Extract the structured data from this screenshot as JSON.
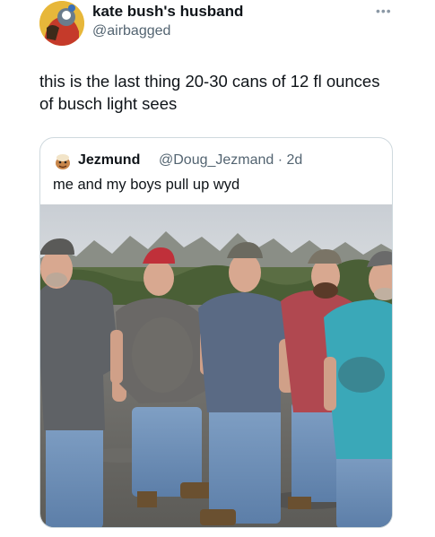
{
  "tweet": {
    "display_name": "kate bush's husband",
    "handle": "@airbagged",
    "more_icon": "more-horizontal-icon",
    "text": "this is the last thing 20-30 cans of 12 fl ounces of busch light sees"
  },
  "quoted_tweet": {
    "display_name": "Jezmund",
    "handle_and_time": "@Doug_Jezmand · 2d",
    "text": "me and my boys pull up wyd",
    "photo": {
      "description_icon": "photo-five-men-parking-lot",
      "hat_colors": [
        "#5a5a58",
        "#c0303a",
        "#6b6a60",
        "#7a7466",
        "#6a6a6a"
      ],
      "shirt_colors": [
        "#5f6266",
        "#6a6866",
        "#5a6a84",
        "#b04850",
        "#3aa8b8"
      ]
    }
  }
}
